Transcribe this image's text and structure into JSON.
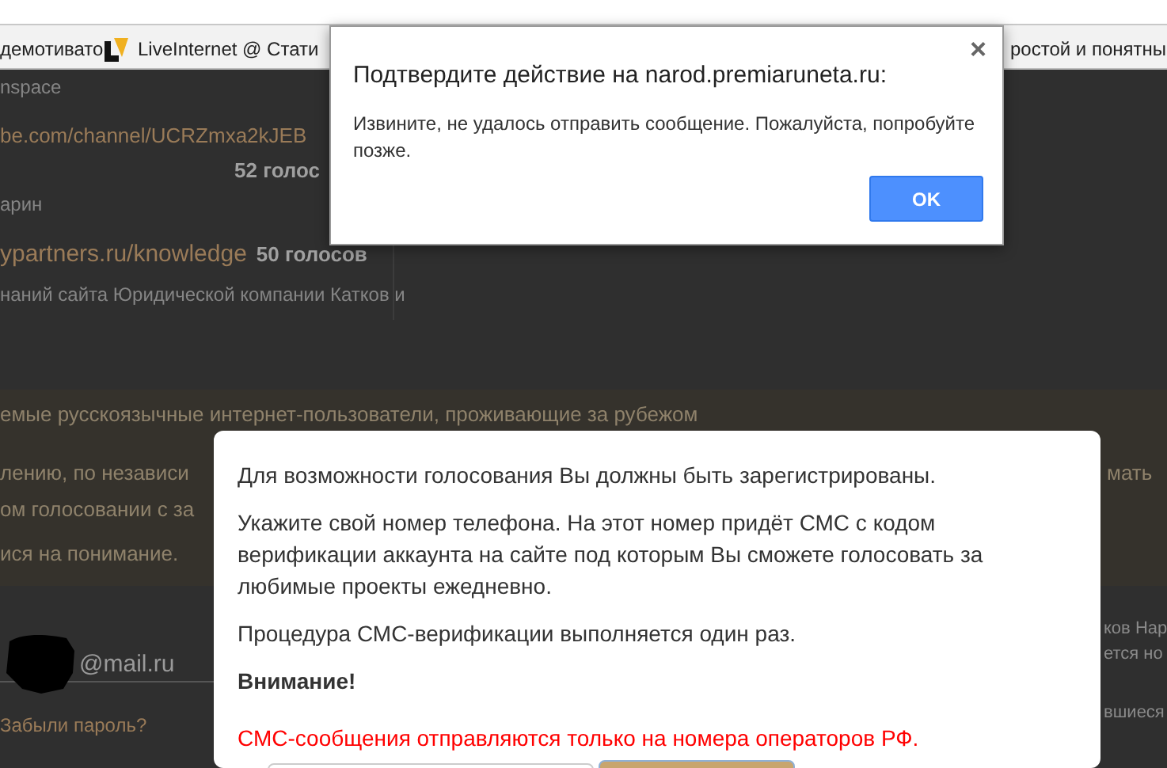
{
  "bookmarks_bar": {
    "items": [
      {
        "label": "демотивато",
        "icon": false
      },
      {
        "label": "LiveInternet @ Стати",
        "icon": true
      },
      {
        "label": "ростой и понятны",
        "icon": false
      }
    ]
  },
  "background_page": {
    "top_list": [
      {
        "kind": "text",
        "text": "nspace"
      },
      {
        "kind": "link",
        "text": "be.com/channel/UCRZmxa2kJEB"
      },
      {
        "kind": "votes",
        "text": "52 голос"
      },
      {
        "kind": "text",
        "text": "арин"
      },
      {
        "kind": "link",
        "text": "ypartners.ru/knowledge"
      },
      {
        "kind": "votes",
        "text": "50 голосов"
      },
      {
        "kind": "text",
        "text": "наний сайта Юридической компании Катков и"
      }
    ],
    "notice_left": [
      "емые русскоязычные интернет-пользователи, проживающие за рубежом",
      "лению, по независи",
      "ом голосовании с за",
      "ися на понимание."
    ],
    "notice_right": [
      "мать"
    ],
    "login": {
      "email_value": "@mail.ru",
      "forgot_link": "Забыли пароль?"
    },
    "right_column": [
      "ков Нар",
      "ется но",
      "вшиеся"
    ]
  },
  "alert_dialog": {
    "title": "Подтвердите действие на narod.premiaruneta.ru:",
    "message": "Извините, не удалось отправить сообщение. Пожалуйста, попробуйте позже.",
    "button": "OK",
    "close": "×"
  },
  "modal": {
    "paragraphs": [
      {
        "kind": "normal",
        "text": "Для возможности голосования Вы должны быть зарегистрированы."
      },
      {
        "kind": "normal",
        "text": "Укажите свой номер телефона. На этот номер придёт СМС с кодом верификации аккаунта на сайте под которым Вы сможете голосовать за любимые проекты ежедневно."
      },
      {
        "kind": "normal",
        "text": "Процедура СМС-верификации выполняется один раз."
      },
      {
        "kind": "strong",
        "text": "Внимание!"
      },
      {
        "kind": "warning",
        "text": "СМС-сообщения отправляются только на номера операторов РФ."
      }
    ]
  }
}
